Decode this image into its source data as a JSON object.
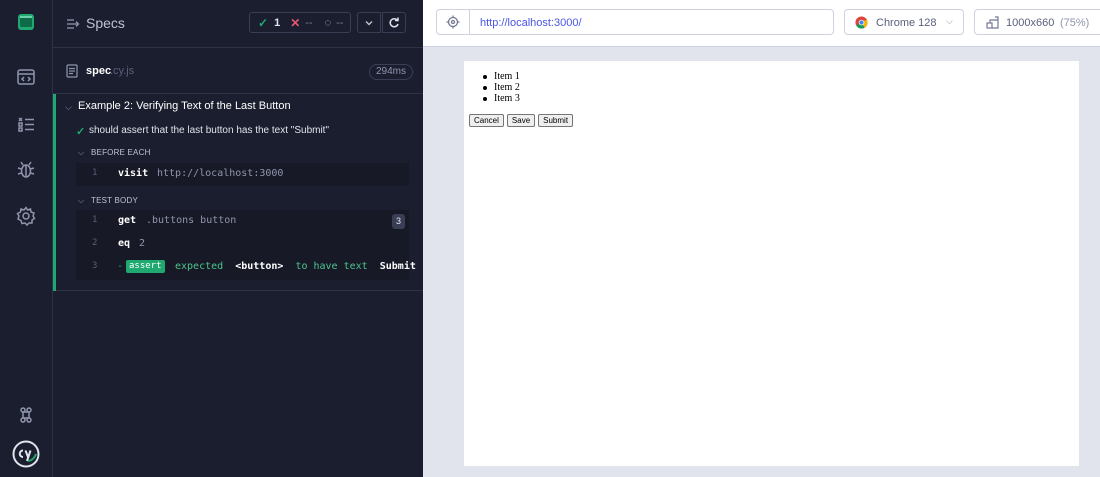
{
  "rail": {
    "items": [
      {
        "icon": "specs-list-icon"
      },
      {
        "icon": "runs-icon"
      },
      {
        "icon": "debug-icon"
      },
      {
        "icon": "settings-icon"
      }
    ],
    "bottom_icon": "keyboard-shortcuts-icon"
  },
  "reporter": {
    "header": {
      "title": "Specs",
      "passed_count": "1",
      "failed_count": "--",
      "pending_count": "--"
    },
    "spec": {
      "name": "spec",
      "ext": ".cy.js",
      "duration": "294ms"
    },
    "suite": {
      "title": "Example 2: Verifying Text of the Last Button",
      "test_title": "should assert that the last button has the text \"Submit\"",
      "before_each_label": "BEFORE EACH",
      "test_body_label": "TEST BODY",
      "before_each_cmds": [
        {
          "num": "1",
          "name": "visit",
          "message": "http://localhost:3000"
        }
      ],
      "body_cmds": [
        {
          "num": "1",
          "name": "get",
          "message": ".buttons button",
          "count": "3"
        },
        {
          "num": "2",
          "name": "eq",
          "message": "2"
        },
        {
          "num": "3",
          "name": "-",
          "assert_tag": "assert",
          "assert_pre": "expected",
          "assert_el": "<button>",
          "assert_mid": "to have text",
          "assert_val": "Submit"
        }
      ]
    }
  },
  "preview": {
    "url": "http://localhost:3000/",
    "browser": "Chrome 128",
    "viewport_size": "1000x660",
    "viewport_scale": "(75%)",
    "aut": {
      "list_items": [
        "Item 1",
        "Item 2",
        "Item 3"
      ],
      "buttons": [
        "Cancel",
        "Save",
        "Submit"
      ]
    }
  },
  "colors": {
    "pass": "#1fa971",
    "fail": "#e45770",
    "url": "#4956e3"
  }
}
